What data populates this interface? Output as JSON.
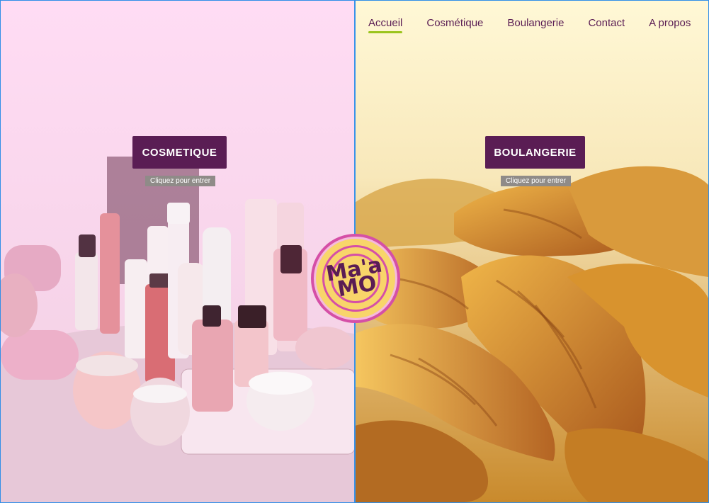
{
  "brand": {
    "logo_text": "Ma'a MO",
    "colors": {
      "primary": "#5a1d54",
      "accent": "#9bc41d",
      "pink": "#d54fa7",
      "yellow": "#f8d56a"
    }
  },
  "nav": {
    "items": [
      {
        "label": "Accueil",
        "active": true
      },
      {
        "label": "Cosmétique",
        "active": false
      },
      {
        "label": "Boulangerie",
        "active": false
      },
      {
        "label": "Contact",
        "active": false
      },
      {
        "label": "A propos",
        "active": false
      }
    ]
  },
  "left": {
    "button_label": "COSMETIQUE",
    "hint_label": "Cliquez pour entrer"
  },
  "right": {
    "button_label": "BOULANGERIE",
    "hint_label": "Cliquez pour entrer"
  }
}
